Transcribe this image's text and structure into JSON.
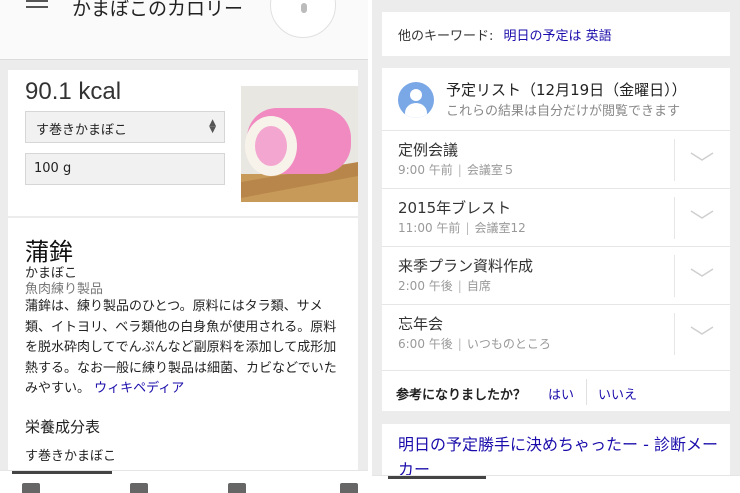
{
  "left": {
    "search": {
      "query": "かまぼこのカロリー"
    },
    "calorie": {
      "value": "90.1 kcal",
      "food_selected": "す巻きかまぼこ",
      "quantity": "100 g"
    },
    "knowledge": {
      "title": "蒲鉾",
      "reading": "かまぼこ",
      "type": "魚肉練り製品",
      "description": "蒲鉾は、練り製品のひとつ。原料にはタラ類、サメ類、イトヨリ、ベラ類他の白身魚が使用される。原料を脱水砕肉してでんぷんなど副原料を添加して成形加熱する。なお一般に練り製品は細菌、カビなどでいたみやすい。",
      "wiki_link": "ウィキペディア",
      "nutrition_title": "栄養成分表",
      "nutrition_item": "す巻きかまぼこ"
    },
    "colors": {
      "link": "#1a0dab",
      "card_bg": "#ffffff",
      "page_bg": "#ececec"
    }
  },
  "right": {
    "keywords": {
      "label": "他のキーワード:",
      "link": "明日の予定は 英語"
    },
    "schedule": {
      "title": "予定リスト（12月19日（金曜日））",
      "subtitle": "これらの結果は自分だけが閲覧できます",
      "events": [
        {
          "title": "定例会議",
          "time": "9:00",
          "ampm": "午前",
          "place": "会議室５"
        },
        {
          "title": "2015年ブレスト",
          "time": "11:00",
          "ampm": "午前",
          "place": "会議室12"
        },
        {
          "title": "来季プラン資料作成",
          "time": "2:00",
          "ampm": "午後",
          "place": "自席"
        },
        {
          "title": "忘年会",
          "time": "6:00",
          "ampm": "午後",
          "place": "いつものところ"
        }
      ]
    },
    "feedback": {
      "question": "参考になりましたか？",
      "yes": "はい",
      "no": "いいえ"
    },
    "result": {
      "link": "明日の予定勝手に決めちゃったー - 診断メーカー"
    }
  }
}
